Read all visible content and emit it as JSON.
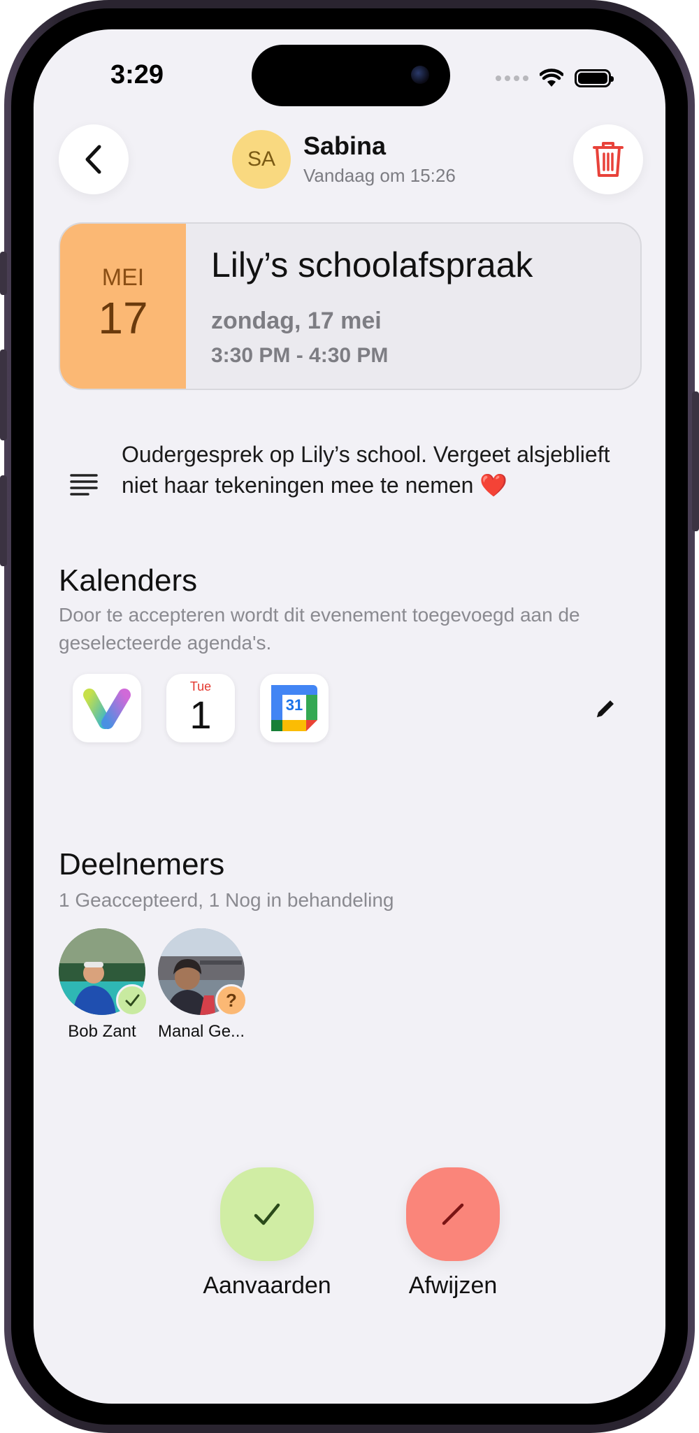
{
  "status_bar": {
    "time": "3:29"
  },
  "header": {
    "sender_initials": "SA",
    "sender_name": "Sabina",
    "sent_time": "Vandaag om 15:26"
  },
  "event": {
    "month": "MEI",
    "day": "17",
    "title": "Lily’s schoolafspraak",
    "date_text": "zondag, 17 mei",
    "time_text": "3:30 PM - 4:30 PM",
    "notes": "Oudergesprek op Lily’s school. Vergeet alsjeblieft niet haar tekeningen mee te nemen ❤️"
  },
  "calendars": {
    "title": "Kalenders",
    "subtitle": "Door te accepteren wordt dit evenement toegevoegd aan de geselecteerde agenda's.",
    "apps": [
      {
        "icon": "v-app-icon"
      },
      {
        "icon": "apple-calendar-icon",
        "weekday": "Tue",
        "day": "1"
      },
      {
        "icon": "google-calendar-icon",
        "day": "31"
      }
    ]
  },
  "participants": {
    "title": "Deelnemers",
    "subtitle": "1 Geaccepteerd, 1 Nog in behandeling",
    "people": [
      {
        "name": "Bob Zant",
        "status": "accepted"
      },
      {
        "name": "Manal Ge...",
        "status": "pending",
        "badge": "?"
      }
    ]
  },
  "actions": {
    "accept_label": "Aanvaarden",
    "decline_label": "Afwijzen"
  },
  "colors": {
    "accept": "#d0eda4",
    "decline": "#fa857a",
    "date_block": "#fbb874",
    "delete": "#e8423a"
  }
}
